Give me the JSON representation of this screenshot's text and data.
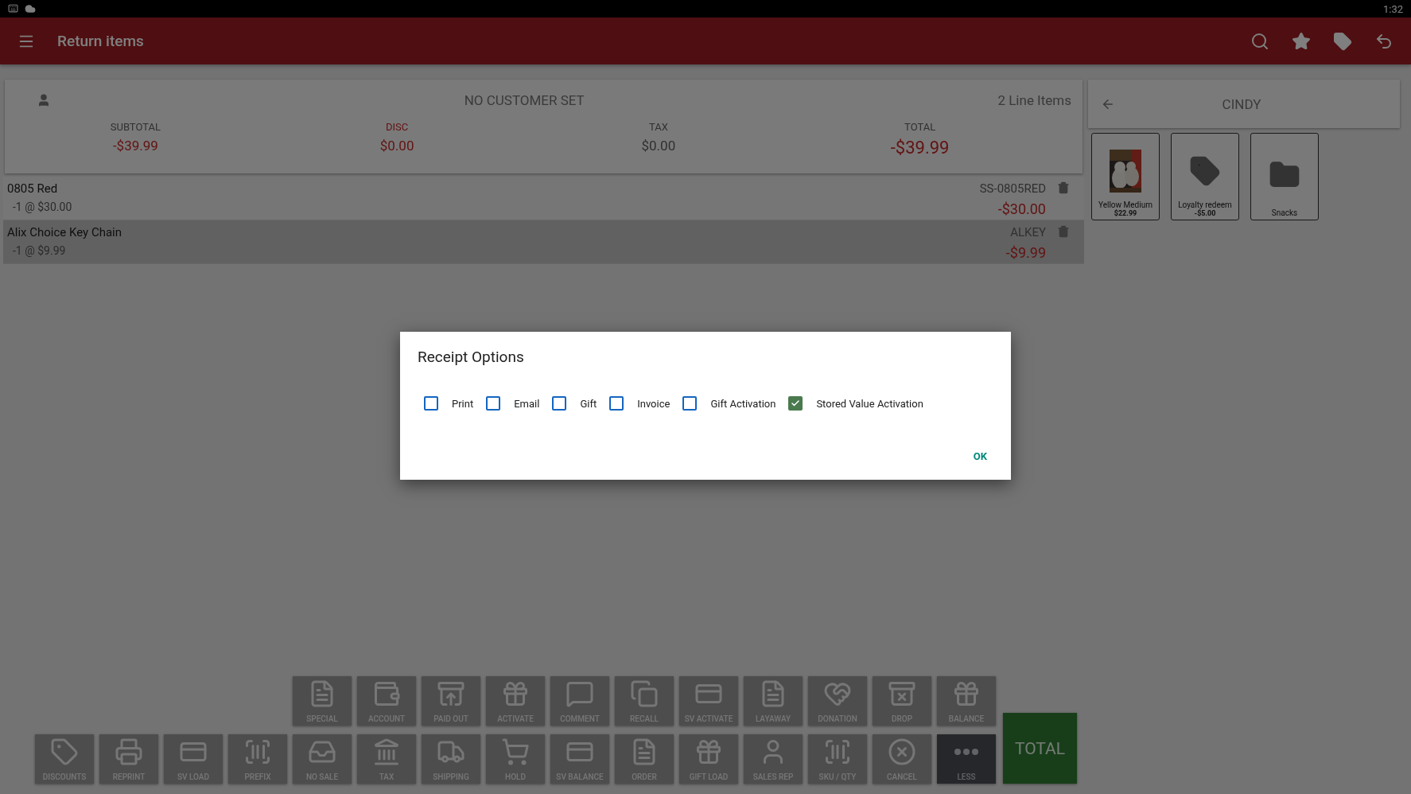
{
  "status_bar": {
    "time": "1:32"
  },
  "app_bar": {
    "title": "Return items"
  },
  "order": {
    "customer": "NO CUSTOMER SET",
    "line_count": "2 Line Items",
    "totals": [
      {
        "kind": "subtotal",
        "label": "SUBTOTAL",
        "value": "-$39.99"
      },
      {
        "kind": "disc",
        "label": "DISC",
        "value": "$0.00"
      },
      {
        "kind": "tax",
        "label": "TAX",
        "value": "$0.00"
      },
      {
        "kind": "total",
        "label": "TOTAL",
        "value": "-$39.99"
      }
    ]
  },
  "line_items": [
    {
      "name": "0805 Red",
      "qty": "-1 @ $30.00",
      "sku": "SS-0805RED",
      "price": "-$30.00",
      "selected": false
    },
    {
      "name": "Alix Choice Key Chain",
      "qty": "-1 @ $9.99",
      "sku": "ALKEY",
      "price": "-$9.99",
      "selected": true
    }
  ],
  "side_panel": {
    "title": "CINDY",
    "tiles": [
      {
        "kind": "picture",
        "label": "Yellow Medium",
        "price": "$22.99"
      },
      {
        "kind": "tag",
        "label": "Loyalty redeem",
        "price": "-$5.00"
      },
      {
        "kind": "folder",
        "label": "Snacks"
      }
    ]
  },
  "function_buttons": [
    [
      {
        "label": "SPECIAL",
        "disabled": false
      },
      {
        "label": "ACCOUNT",
        "disabled": false
      },
      {
        "label": "PAID OUT",
        "disabled": false
      },
      {
        "label": "ACTIVATE",
        "disabled": false
      },
      {
        "label": "COMMENT",
        "disabled": false
      },
      {
        "label": "RECALL",
        "disabled": false
      },
      {
        "label": "SV ACTIVATE",
        "disabled": false
      },
      {
        "label": "LAYAWAY",
        "disabled": false
      },
      {
        "label": "DONATION",
        "disabled": false
      },
      {
        "label": "DROP",
        "disabled": false
      },
      {
        "label": "BALANCE",
        "disabled": false
      }
    ],
    [
      {
        "label": "DISCOUNTS",
        "disabled": false
      },
      {
        "label": "REPRINT",
        "disabled": false
      },
      {
        "label": "SV LOAD",
        "disabled": false
      },
      {
        "label": "PREFIX",
        "disabled": false
      },
      {
        "label": "NO SALE",
        "disabled": false
      },
      {
        "label": "TAX",
        "disabled": false
      },
      {
        "label": "SHIPPING",
        "disabled": false
      },
      {
        "label": "HOLD",
        "disabled": false
      },
      {
        "label": "SV BALANCE",
        "disabled": false
      },
      {
        "label": "ORDER",
        "disabled": false
      },
      {
        "label": "GIFT LOAD",
        "disabled": false
      },
      {
        "label": "SALES REP",
        "disabled": false
      },
      {
        "label": "SKU / QTY",
        "disabled": false
      },
      {
        "label": "CANCEL",
        "disabled": false
      },
      {
        "label": "LESS",
        "disabled": true
      }
    ]
  ],
  "total_button": "TOTAL",
  "dialog": {
    "title": "Receipt Options",
    "options": [
      {
        "label": "Print",
        "checked": false
      },
      {
        "label": "Email",
        "checked": false
      },
      {
        "label": "Gift",
        "checked": false
      },
      {
        "label": "Invoice",
        "checked": false
      },
      {
        "label": "Gift Activation",
        "checked": false
      },
      {
        "label": "Stored Value Activation",
        "checked": true
      }
    ],
    "ok_button": "OK"
  }
}
